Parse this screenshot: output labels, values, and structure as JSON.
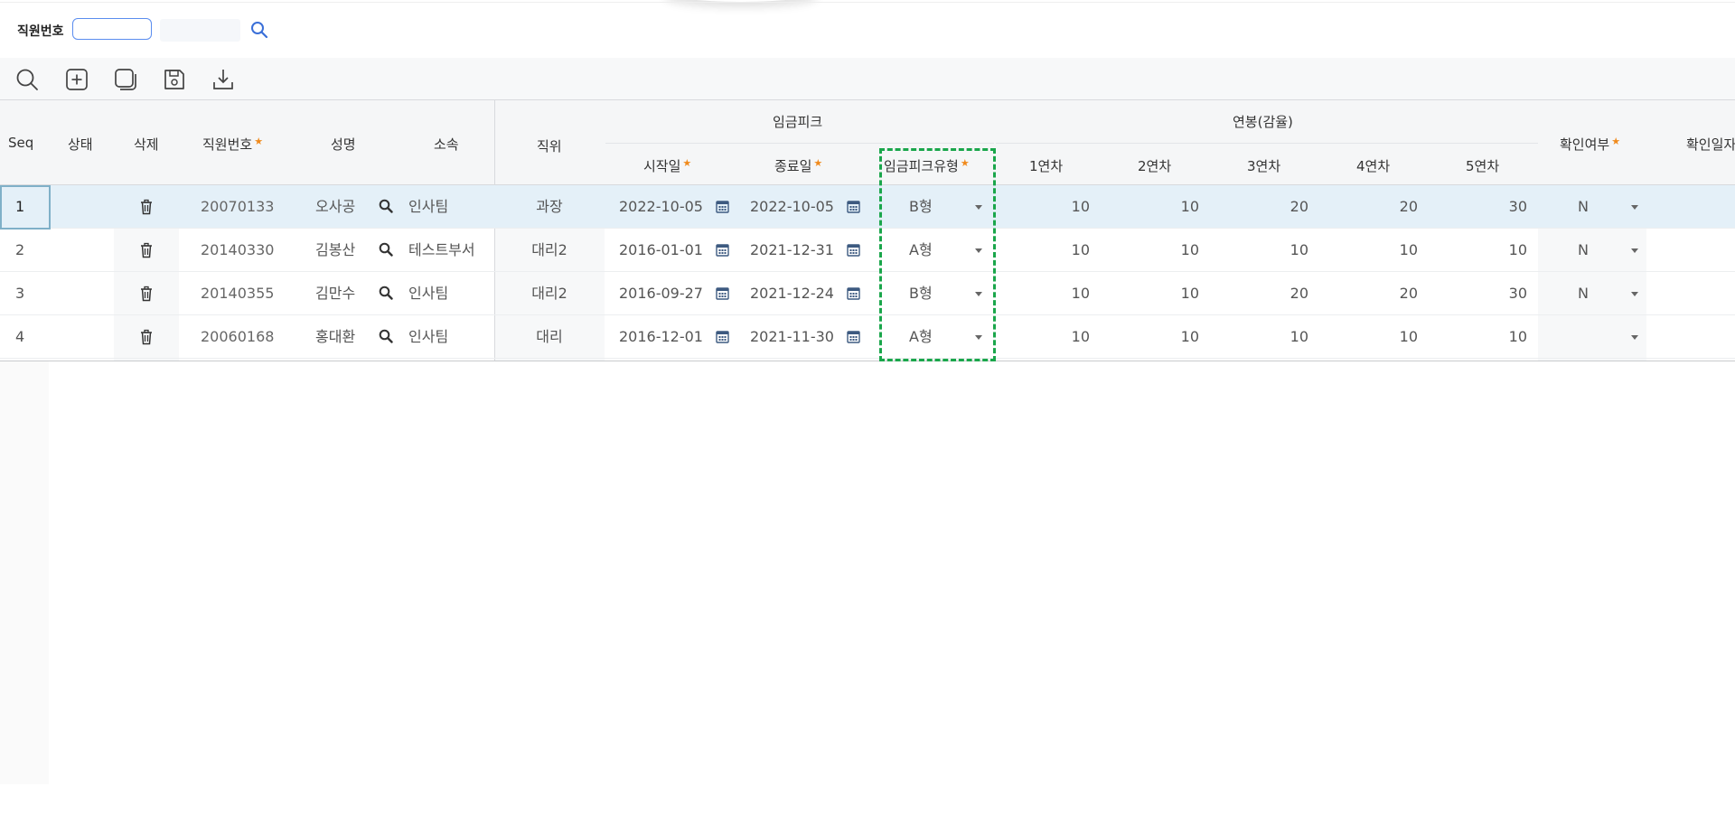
{
  "search": {
    "label": "직원번호",
    "value": "",
    "placeholder": ""
  },
  "toolbar": {
    "icons": [
      "search-icon",
      "add-icon",
      "copy-icon",
      "save-icon",
      "download-icon"
    ]
  },
  "grid": {
    "headers": {
      "seq": "Seq",
      "status": "상태",
      "delete": "삭제",
      "emp_no": "직원번호",
      "name": "성명",
      "dept": "소속",
      "position": "직위",
      "wage_peak": "임금피크",
      "start_date": "시작일",
      "end_date": "종료일",
      "peak_type": "임금피크유형",
      "salary": "연봉(감율)",
      "y1": "1연차",
      "y2": "2연차",
      "y3": "3연차",
      "y4": "4연차",
      "y5": "5연차",
      "confirm": "확인여부",
      "confirm_date": "확인일자"
    },
    "rows": [
      {
        "seq": "1",
        "emp_no": "20070133",
        "name": "오사공",
        "dept": "인사팀",
        "position": "과장",
        "start": "2022-10-05",
        "end": "2022-10-05",
        "type": "B형",
        "y1": "10",
        "y2": "10",
        "y3": "20",
        "y4": "20",
        "y5": "30",
        "confirm": "N"
      },
      {
        "seq": "2",
        "emp_no": "20140330",
        "name": "김봉산",
        "dept": "테스트부서",
        "position": "대리2",
        "start": "2016-01-01",
        "end": "2021-12-31",
        "type": "A형",
        "y1": "10",
        "y2": "10",
        "y3": "10",
        "y4": "10",
        "y5": "10",
        "confirm": "N"
      },
      {
        "seq": "3",
        "emp_no": "20140355",
        "name": "김만수",
        "dept": "인사팀",
        "position": "대리2",
        "start": "2016-09-27",
        "end": "2021-12-24",
        "type": "B형",
        "y1": "10",
        "y2": "10",
        "y3": "20",
        "y4": "20",
        "y5": "30",
        "confirm": "N"
      },
      {
        "seq": "4",
        "emp_no": "20060168",
        "name": "홍대환",
        "dept": "인사팀",
        "position": "대리",
        "start": "2016-12-01",
        "end": "2021-11-30",
        "type": "A형",
        "y1": "10",
        "y2": "10",
        "y3": "10",
        "y4": "10",
        "y5": "10",
        "confirm": ""
      }
    ]
  },
  "colors": {
    "accent": "#3a6fd8",
    "required_star": "#f08a1c",
    "selected_row": "#e4f0f8",
    "highlight_box": "#1aa64b"
  }
}
